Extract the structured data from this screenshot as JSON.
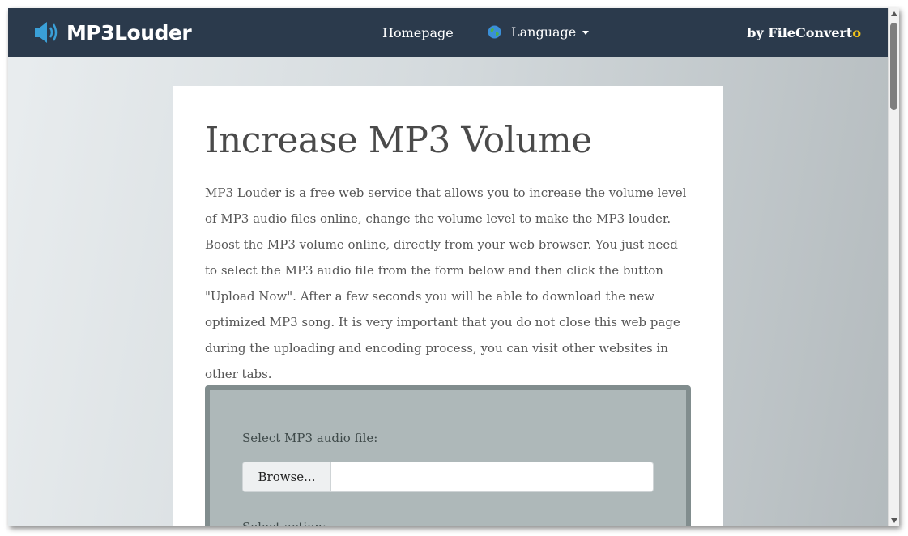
{
  "navbar": {
    "logo_text": "MP3Louder",
    "home_label": "Homepage",
    "language_label": "Language",
    "by_text": "by FileConvert",
    "by_accent": "o"
  },
  "main": {
    "title": "Increase MP3 Volume",
    "description": "MP3 Louder is a free web service that allows you to increase the volume level of MP3 audio files online, change the volume level to make the MP3 louder. Boost the MP3 volume online, directly from your web browser. You just need to select the MP3 audio file from the form below and then click the button \"Upload Now\". After a few seconds you will be able to download the new optimized MP3 song. It is very important that you do not close this web page during the uploading and encoding process, you can visit other websites in other tabs."
  },
  "form": {
    "file_label": "Select MP3 audio file:",
    "browse_label": "Browse...",
    "file_value": "",
    "action_label": "Select action:"
  },
  "icons": {
    "logo": "speaker-icon",
    "language": "globe-icon",
    "dropdown": "caret-down-icon"
  },
  "colors": {
    "navbar": "#2b3a4c",
    "accent": "#f5c518",
    "logo_blue": "#3aa0d8",
    "form_panel": "#aeb8b9",
    "form_border": "#818d8e"
  }
}
